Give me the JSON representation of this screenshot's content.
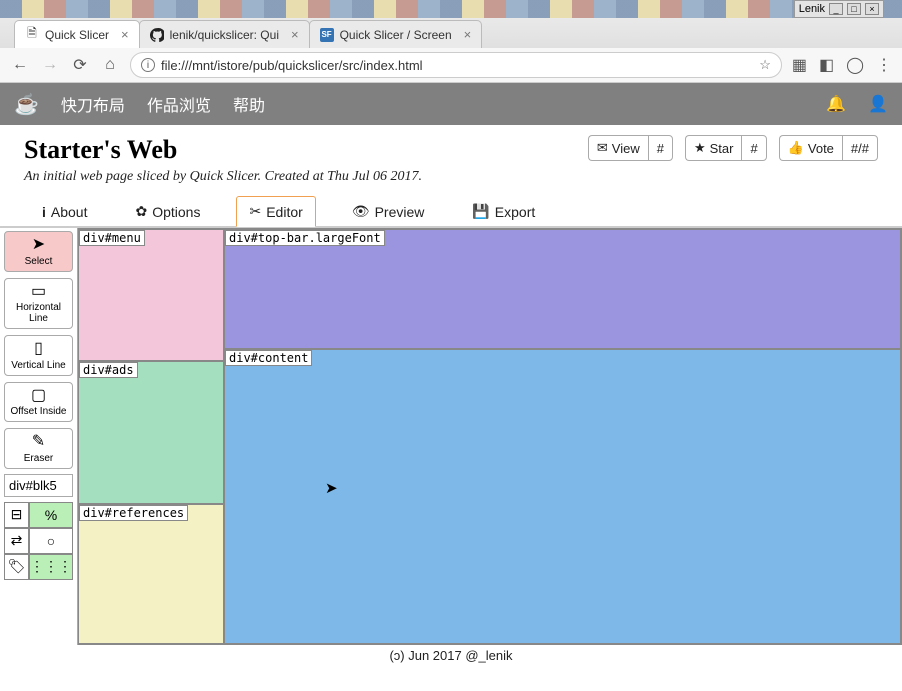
{
  "os": {
    "user": "Lenik"
  },
  "browser": {
    "tabs": [
      {
        "label": "Quick Slicer",
        "favicon": "doc"
      },
      {
        "label": "lenik/quickslicer: Qui",
        "favicon": "github"
      },
      {
        "label": "Quick Slicer / Screen",
        "favicon": "sf"
      }
    ],
    "url": "file:///mnt/istore/pub/quickslicer/src/index.html"
  },
  "nav": {
    "links": [
      "快刀布局",
      "作品浏览",
      "帮助"
    ]
  },
  "header": {
    "title": "Starter's Web",
    "subtitle": "An initial web page sliced by Quick Slicer. Created at Thu Jul 06 2017.",
    "buttons": {
      "view": {
        "label": "View",
        "badge": "#"
      },
      "star": {
        "label": "Star",
        "badge": "#"
      },
      "vote": {
        "label": "Vote",
        "badge": "#/#"
      }
    }
  },
  "tabs": {
    "about": {
      "label": "About"
    },
    "options": {
      "label": "Options"
    },
    "editor": {
      "label": "Editor"
    },
    "preview": {
      "label": "Preview"
    },
    "export": {
      "label": "Export"
    }
  },
  "tools": {
    "select": {
      "label": "Select"
    },
    "hline": {
      "label": "Horizontal Line"
    },
    "vline": {
      "label": "Vertical Line"
    },
    "offsetInside": {
      "label": "Offset Inside"
    },
    "eraser": {
      "label": "Eraser"
    },
    "selector_value": "div#blk5",
    "pct": "%"
  },
  "regions": {
    "menu": "div#menu",
    "ads": "div#ads",
    "refs": "div#references",
    "topbar": "div#top-bar.largeFont",
    "content": "div#content"
  },
  "footer": "(ɔ) Jun 2017 @_lenik"
}
